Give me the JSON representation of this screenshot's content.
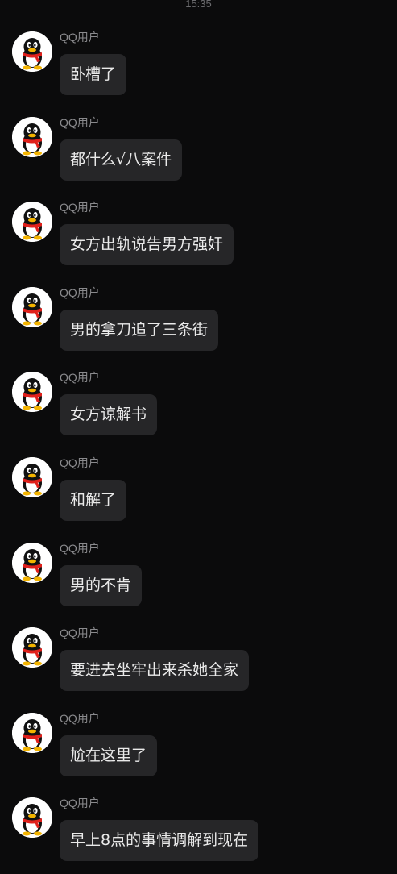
{
  "status": {
    "time": "15:35"
  },
  "messages": [
    {
      "sender": "QQ用户",
      "text": "卧槽了"
    },
    {
      "sender": "QQ用户",
      "text": "都什么√八案件"
    },
    {
      "sender": "QQ用户",
      "text": "女方出轨说告男方强奸"
    },
    {
      "sender": "QQ用户",
      "text": "男的拿刀追了三条街"
    },
    {
      "sender": "QQ用户",
      "text": "女方谅解书"
    },
    {
      "sender": "QQ用户",
      "text": "和解了"
    },
    {
      "sender": "QQ用户",
      "text": "男的不肯"
    },
    {
      "sender": "QQ用户",
      "text": "要进去坐牢出来杀她全家"
    },
    {
      "sender": "QQ用户",
      "text": "尬在这里了"
    },
    {
      "sender": "QQ用户",
      "text": "早上8点的事情调解到现在"
    }
  ],
  "icons": {
    "avatar": "qq-penguin-avatar-icon"
  },
  "colors": {
    "background": "#0b0b0c",
    "bubble": "#262628",
    "text": "#eaeaea",
    "sender": "#8a8a8d",
    "scarf": "#e0201b",
    "beak": "#f4b400"
  }
}
